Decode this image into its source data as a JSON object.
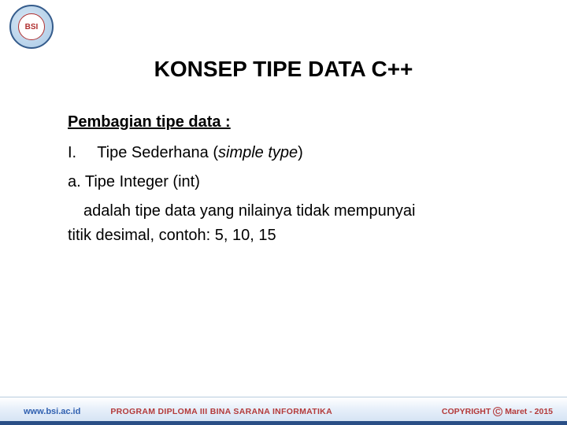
{
  "logo": {
    "text": "BSI"
  },
  "title": "KONSEP TIPE DATA C++",
  "subtitle": "Pembagian tipe data :",
  "roman": "I.",
  "roman_label_prefix": "Tipe Sederhana (",
  "roman_label_italic": "simple type",
  "roman_label_suffix": ")",
  "sub_a": "a. Tipe Integer (int)",
  "desc_line1": "adalah tipe data yang nilainya tidak mempunyai",
  "desc_line2": "titik desimal, contoh: 5, 10, 15",
  "footer": {
    "url": "www.bsi.ac.id",
    "program": "PROGRAM DIPLOMA III BINA SARANA INFORMATIKA",
    "copyright_word": "COPYRIGHT",
    "copyright_symbol": "C",
    "copyright_date": "Maret - 2015"
  }
}
